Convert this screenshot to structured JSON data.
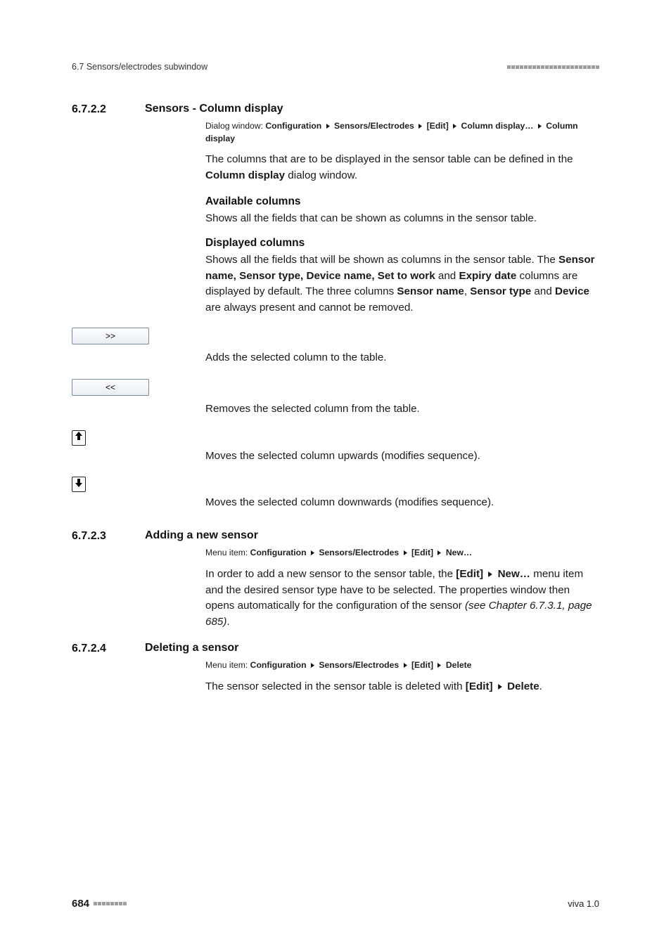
{
  "header": {
    "left": "6.7 Sensors/electrodes subwindow"
  },
  "s1": {
    "num": "6.7.2.2",
    "title": "Sensors - Column display",
    "path": {
      "label": "Dialog window: ",
      "seg1": "Configuration",
      "seg2": "Sensors/Electrodes",
      "seg3": "[Edit]",
      "seg4": "Column display…",
      "seg5": "Column display"
    },
    "p1a": "The columns that are to be displayed in the sensor table can be defined in the ",
    "p1b": "Column display",
    "p1c": " dialog window.",
    "avail_h": "Available columns",
    "avail_p": "Shows all the fields that can be shown as columns in the sensor table.",
    "disp_h": "Displayed columns",
    "disp_p_a": "Shows all the fields that will be shown as columns in the sensor table. The ",
    "disp_p_b": "Sensor name, Sensor type, Device name, Set to work",
    "disp_p_c": " and ",
    "disp_p_d": "Expiry date",
    "disp_p_e": " columns are displayed by default. The three columns ",
    "disp_p_f": "Sensor name",
    "disp_p_g": ", ",
    "disp_p_h": "Sensor type",
    "disp_p_i": " and ",
    "disp_p_j": "Device",
    "disp_p_k": " are always present and cannot be removed.",
    "btn_add": ">>",
    "btn_add_desc": "Adds the selected column to the table.",
    "btn_rem": "<<",
    "btn_rem_desc": "Removes the selected column from the table.",
    "btn_up_desc": "Moves the selected column upwards (modifies sequence).",
    "btn_dn_desc": "Moves the selected column downwards (modifies sequence)."
  },
  "s2": {
    "num": "6.7.2.3",
    "title": "Adding a new sensor",
    "path": {
      "label": "Menu item: ",
      "seg1": "Configuration",
      "seg2": "Sensors/Electrodes",
      "seg3": "[Edit]",
      "seg4": "New…"
    },
    "p_a": "In order to add a new sensor to the sensor table, the ",
    "p_b": "[Edit]",
    "p_c": "New…",
    "p_d": " menu item and the desired sensor type have to be selected. The properties window then opens automatically for the configuration of the sensor ",
    "p_e": "(see Chapter 6.7.3.1, page 685)",
    "p_f": "."
  },
  "s3": {
    "num": "6.7.2.4",
    "title": "Deleting a sensor",
    "path": {
      "label": "Menu item: ",
      "seg1": "Configuration",
      "seg2": "Sensors/Electrodes",
      "seg3": "[Edit]",
      "seg4": "Delete"
    },
    "p_a": "The sensor selected in the sensor table is deleted with ",
    "p_b": "[Edit]",
    "p_c": "Delete",
    "p_d": "."
  },
  "footer": {
    "page": "684",
    "right": "viva 1.0"
  }
}
